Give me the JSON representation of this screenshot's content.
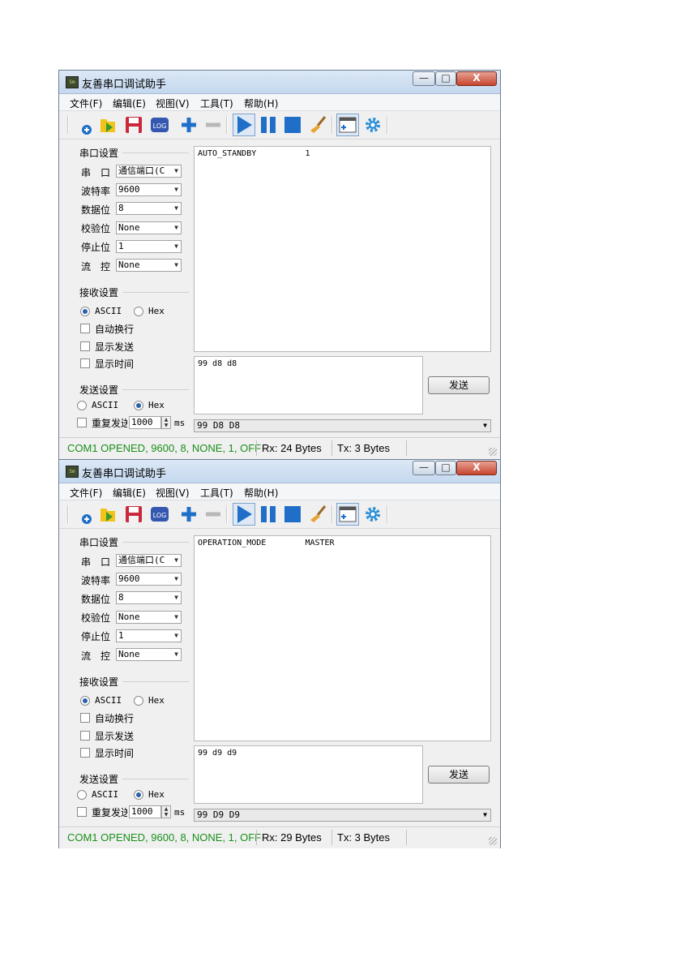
{
  "app": {
    "title": "友善串口调试助手",
    "icon_text": "Sm",
    "min_glyph": "—",
    "max_glyph": "□",
    "close_glyph": "X"
  },
  "menu": [
    "文件(F)",
    "编辑(E)",
    "视图(V)",
    "工具(T)",
    "帮助(H)"
  ],
  "toolbar_icons": [
    "new-connection-icon",
    "open-folder-icon",
    "save-icon",
    "log-icon",
    "add-icon",
    "remove-icon",
    "play-icon",
    "pause-icon",
    "stop-icon",
    "broom-clear-icon",
    "window-add-icon",
    "settings-gear-icon"
  ],
  "toolbar_log_text": "LOG",
  "serial": {
    "group_title": "串口设置",
    "port_label": "串　口",
    "port_value": "通信端口(C",
    "baud_label": "波特率",
    "baud_value": "9600",
    "data_label": "数据位",
    "data_value": "8",
    "parity_label": "校验位",
    "parity_value": "None",
    "stop_label": "停止位",
    "stop_value": "1",
    "flow_label": "流　控",
    "flow_value": "None"
  },
  "receive": {
    "group_title": "接收设置",
    "ascii_label": "ASCII",
    "hex_label": "Hex",
    "auto_wrap_label": "自动换行",
    "show_send_label": "显示发送",
    "show_time_label": "显示时间"
  },
  "send": {
    "group_title": "发送设置",
    "ascii_label": "ASCII",
    "hex_label": "Hex",
    "repeat_label": "重复发送",
    "repeat_interval": "1000",
    "interval_unit": "ms",
    "send_button": "发送"
  },
  "windows": [
    {
      "recv_text": "AUTO_STANDBY          1",
      "send_text": "99 d8 d8",
      "history_value": "99 D8 D8",
      "status_main": "COM1 OPENED, 9600, 8, NONE, 1, OFF",
      "status_rx": "Rx: 24 Bytes",
      "status_tx": "Tx: 3 Bytes"
    },
    {
      "recv_text": "OPERATION_MODE        MASTER",
      "send_text": "99 d9 d9",
      "history_value": "99 D9 D9",
      "status_main": "COM1 OPENED, 9600, 8, NONE, 1, OFF",
      "status_rx": "Rx: 29 Bytes",
      "status_tx": "Tx: 3 Bytes"
    }
  ],
  "colors": {
    "status_green": "#1a8f1a",
    "icon_blue": "#1f6fc9",
    "close_red": "#c7452f"
  }
}
